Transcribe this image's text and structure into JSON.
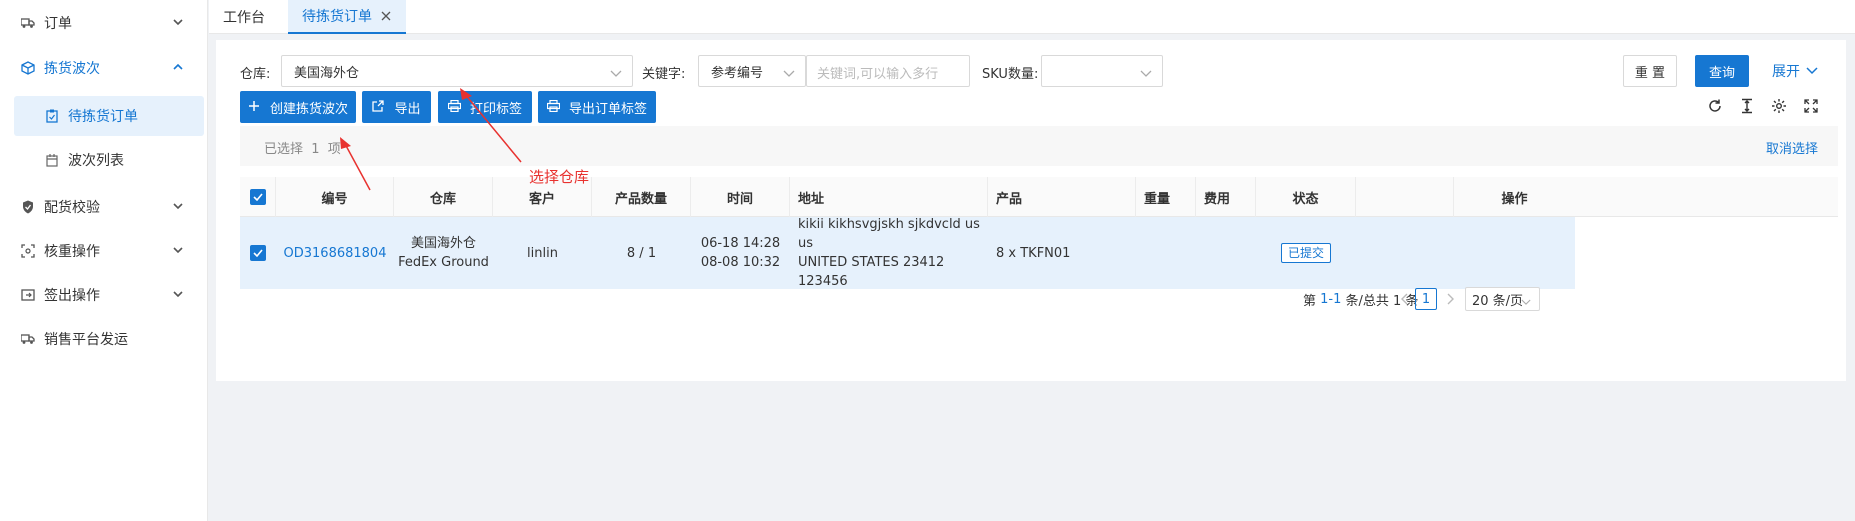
{
  "sidebar": {
    "items": [
      {
        "label": "订单",
        "icon": "truck-icon",
        "expanded": false
      },
      {
        "label": "拣货波次",
        "icon": "box-icon",
        "expanded": true
      },
      {
        "label": "配货校验",
        "icon": "shield-icon",
        "expanded": false
      },
      {
        "label": "核重操作",
        "icon": "scan-icon",
        "expanded": false
      },
      {
        "label": "签出操作",
        "icon": "exit-icon",
        "expanded": false
      },
      {
        "label": "销售平台发运",
        "icon": "truck-icon",
        "expanded": false
      }
    ],
    "sub_items": [
      {
        "label": "待拣货订单",
        "active": true
      },
      {
        "label": "波次列表",
        "active": false
      }
    ]
  },
  "tabs": [
    {
      "label": "工作台",
      "active": false
    },
    {
      "label": "待拣货订单",
      "active": true
    }
  ],
  "filters": {
    "warehouse_label": "仓库:",
    "warehouse_value": "美国海外仓",
    "keyword_label": "关键字:",
    "keyword_type": "参考编号",
    "keyword_placeholder": "关键词,可以输入多行",
    "sku_label": "SKU数量:",
    "sku_value": ""
  },
  "actions": {
    "reset": "重 置",
    "query": "查询",
    "expand": "展开",
    "create_wave": "创建拣货波次",
    "export": "导出",
    "print_label": "打印标签",
    "export_order_label": "导出订单标签"
  },
  "selection": {
    "text": "已选择  1  项",
    "cancel": "取消选择"
  },
  "table": {
    "headers": [
      "编号",
      "仓库",
      "客户",
      "产品数量",
      "时间",
      "地址",
      "产品",
      "重量",
      "费用",
      "状态",
      "",
      "操作"
    ],
    "rows": [
      {
        "checked": true,
        "id": "OD3168681804",
        "warehouse": [
          "美国海外仓",
          "FedEx Ground"
        ],
        "customer": "linlin",
        "qty": "8 / 1",
        "time": [
          "06-18 14:28",
          "08-08 10:32"
        ],
        "address": [
          "kikii kikhsvgjskh sjkdvcld us us",
          "UNITED STATES 23412",
          "123456"
        ],
        "product": "8 x TKFN01",
        "weight": "",
        "fee": "",
        "status": "已提交"
      }
    ]
  },
  "pagination": {
    "summary_prefix": "第 ",
    "summary_range": "1-1",
    "summary_suffix": " 条/总共 1 条",
    "current_page": "1",
    "page_size": "20 条/页"
  },
  "annotation": {
    "text": "选择仓库",
    "color": "#e8322f"
  },
  "colors": {
    "accent": "#1677d2",
    "row_highlight": "#e6f1fc"
  }
}
